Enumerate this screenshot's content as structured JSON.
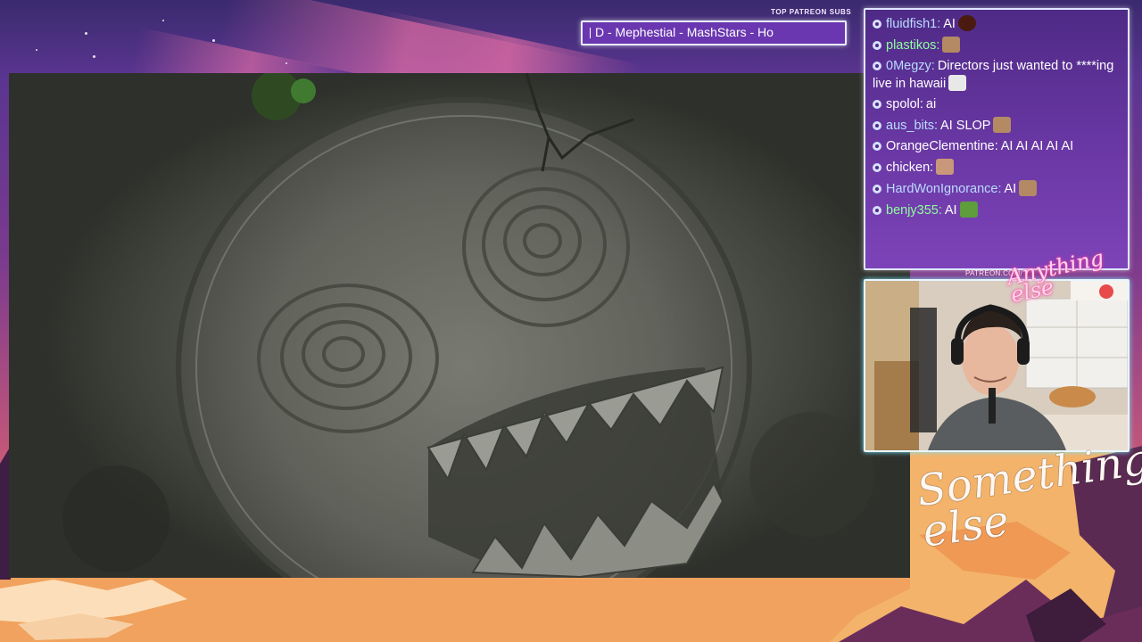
{
  "patreon": {
    "label": "TOP PATREON SUBS",
    "ticker": "D - Mephestial - MashStars - Ho",
    "url": "PATREON.COM/"
  },
  "chat": {
    "messages": [
      {
        "user": "fluidfish1:",
        "text": "AI",
        "user_color": "#b9dcff",
        "emote": "dark-orb-emote",
        "emote_color": "#4a1a10"
      },
      {
        "user": "plastikos:",
        "text": "",
        "user_color": "#8dff9c",
        "emote": "bearded-man-emote",
        "emote_color": "#b38a63"
      },
      {
        "user": "0Megzy:",
        "text": "Directors just wanted to ****ing live in hawaii",
        "user_color": "#b9dcff",
        "emote": "sunglasses-face-emote",
        "emote_color": "#e8e8e8"
      },
      {
        "user": "spolol:",
        "text": "ai",
        "user_color": "#ffffff",
        "emote": "",
        "emote_color": ""
      },
      {
        "user": "aus_bits:",
        "text": "AI SLOP",
        "user_color": "#b9dcff",
        "emote": "bearded-man-emote",
        "emote_color": "#b38a63"
      },
      {
        "user": "OrangeClementine:",
        "text": "AI AI AI AI AI",
        "user_color": "#ffffff",
        "emote": "",
        "emote_color": ""
      },
      {
        "user": "chicken:",
        "text": "",
        "user_color": "#ffffff",
        "emote": "face-photo-emote",
        "emote_color": "#c9977a"
      },
      {
        "user": "HardWonIgnorance:",
        "text": "AI",
        "user_color": "#b9dcff",
        "emote": "bearded-man-emote",
        "emote_color": "#b38a63"
      },
      {
        "user": "benjy355:",
        "text": "AI",
        "user_color": "#8dff9c",
        "emote": "pepe-frog-emote",
        "emote_color": "#5e9c3c"
      }
    ]
  },
  "webcam_logo": "Anything\nelse",
  "brand_logo": "Something\nelse",
  "colors": {
    "chat_bg": "#5a2f95",
    "chat_border": "#dfe6ff",
    "webcam_glow": "#7be6ff",
    "background_top": "#3a2a6e",
    "background_bottom": "#f2a058"
  }
}
